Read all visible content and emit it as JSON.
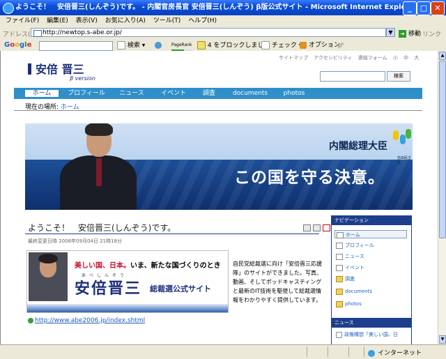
{
  "window": {
    "title": "ようこそ！　安倍晋三(しんぞう)です。 - 内閣官房長官 安倍晋三(しんぞう) β版公式サイト - Microsoft Internet Explorer"
  },
  "menu": [
    "ファイル(F)",
    "編集(E)",
    "表示(V)",
    "お気に入り(A)",
    "ツール(T)",
    "ヘルプ(H)"
  ],
  "address": {
    "label": "アドレス(D)",
    "url": "http://newtop.s-abe.or.jp/",
    "go_label": "移動",
    "links_label": "リンク"
  },
  "google_toolbar": {
    "logo": [
      "G",
      "o",
      "o",
      "g",
      "l",
      "e"
    ],
    "search_label": "検索",
    "pagerank_label": "PageRank",
    "popup_blocked": "4 をブロックしました",
    "check_label": "チェック",
    "options_label": "オプション"
  },
  "site": {
    "logo_text": "安倍 晋三",
    "beta": "β version",
    "top_links": [
      "サイトマップ",
      "アクセシビリティ",
      "連絡フォーム",
      "小",
      "中",
      "大"
    ],
    "search_button": "検索",
    "nav": [
      "ホーム",
      "プロフィール",
      "ニュース",
      "イベント",
      "調査",
      "documents",
      "photos"
    ],
    "breadcrumb_prefix": "現在の場所:",
    "breadcrumb_link": "ホーム",
    "banner_title": "内閣総理大臣",
    "banner_slogan": "この国を守る決意。",
    "banner_party": "自由民主党",
    "page_title": "ようこそ！　安倍晋三(しんぞう)です。",
    "updated": "最終変更日時 2006年09月04日 21時18分",
    "campaign_red": "美しい国、日本。",
    "campaign_rest": "いま、新たな国づくりのとき",
    "campaign_ruby": "あべしんぞう",
    "campaign_name": "安倍晋三",
    "campaign_sub": "総裁選公式サイト",
    "campaign_desc": "自民党総裁選に向け「安倍晋三応援隊」のサイトができました。写真、動画、そしてポッドキャスティングと最新のIT技術を駆使して総裁選情報をわかりやすく提供しています。",
    "campaign_url": "http://www.abe2006.jp/index.shtml"
  },
  "sidebar": {
    "title": "ナビゲーション",
    "items": [
      "ホーム",
      "プロフィール",
      "ニュース",
      "イベント",
      "調査",
      "documents",
      "photos"
    ],
    "news_title": "ニュース",
    "news_item": "政権構想「美しい国、日"
  },
  "status": {
    "zone": "インターネット"
  }
}
